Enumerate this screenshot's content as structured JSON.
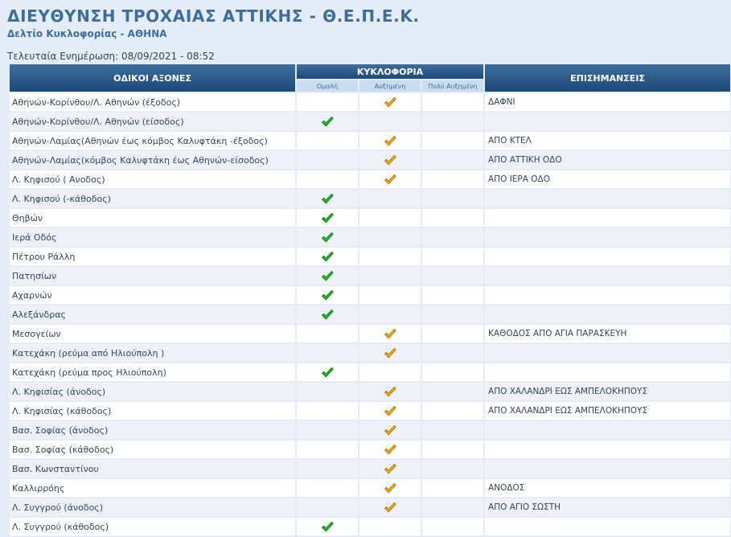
{
  "header": {
    "title": "ΔΙΕΥΘΥΝΣΗ ΤΡΟΧΑΙΑΣ ΑΤΤΙΚΗΣ - Θ.Ε.Π.Ε.Κ.",
    "subtitle": "Δελτίο Κυκλοφορίας - ΑΘΗΝΑ",
    "updated_label": "Τελευταία Ενημέρωση:",
    "updated_value": "08/09/2021 - 08:52"
  },
  "table": {
    "col_axes": "ΟΔΙΚΟΙ ΑΞΟΝΕΣ",
    "col_traffic": "ΚΥΚΛΟΦΟΡΙΑ",
    "col_notes": "ΕΠΙΣΗΜΑΝΣΕΙΣ",
    "sub_normal": "Ομαλή",
    "sub_increased": "Αυξημένη",
    "sub_very_increased": "Πολύ Αυξημένη",
    "icons": {
      "normal": "green-check-icon",
      "increased": "orange-check-icon"
    },
    "colors": {
      "normal": "#22b422",
      "increased": "#f0a818",
      "header": "#2a5a8a"
    },
    "rows": [
      {
        "axis": "Αθηνών-Κορίνθου/Λ. Αθηνών (έξοδος)",
        "status": "increased",
        "note": "ΔΑΦΝΙ"
      },
      {
        "axis": "Αθηνών-Κορίνθου/Λ. Αθηνών (είσοδος)",
        "status": "normal",
        "note": ""
      },
      {
        "axis": "Αθηνών-Λαμίας(Αθηνών έως κόμβος Καλυφτάκη -έξοδος)",
        "status": "increased",
        "note": "ΑΠΟ ΚΤΕΛ"
      },
      {
        "axis": "Αθηνών-Λαμίας(κόμβος Καλυφτάκη έως Αθηνών-είσοδος)",
        "status": "increased",
        "note": "ΑΠΟ ΑΤΤΙΚΗ ΟΔΟ"
      },
      {
        "axis": "Λ. Κηφισού ( Ανοδος)",
        "status": "increased",
        "note": "ΑΠΟ ΙΕΡΑ ΟΔΟ"
      },
      {
        "axis": "Λ. Κηφισού (-κάθοδος)",
        "status": "normal",
        "note": ""
      },
      {
        "axis": "Θηβών",
        "status": "normal",
        "note": ""
      },
      {
        "axis": "Ιερά Οδός",
        "status": "normal",
        "note": ""
      },
      {
        "axis": "Πέτρου Ράλλη",
        "status": "normal",
        "note": ""
      },
      {
        "axis": "Πατησίων",
        "status": "normal",
        "note": ""
      },
      {
        "axis": "Αχαρνών",
        "status": "normal",
        "note": ""
      },
      {
        "axis": "Αλεξάνδρας",
        "status": "normal",
        "note": ""
      },
      {
        "axis": "Μεσογείων",
        "status": "increased",
        "note": "ΚΑΘΟΔΟΣ ΑΠΟ ΑΓΙΑ ΠΑΡΑΣΚΕΥΗ"
      },
      {
        "axis": "Κατεχάκη (ρεύμα από Ηλιούπολη )",
        "status": "increased",
        "note": ""
      },
      {
        "axis": "Κατεχάκη (ρεύμα προς Ηλιούπολη)",
        "status": "normal",
        "note": ""
      },
      {
        "axis": "Λ. Κηφισίας (άνοδος)",
        "status": "increased",
        "note": "ΑΠΟ ΧΑΛΑΝΔΡΙ ΕΩΣ ΑΜΠΕΛΟΚΗΠΟΥΣ"
      },
      {
        "axis": "Λ. Κηφισίας (κάθοδος)",
        "status": "increased",
        "note": "ΑΠΟ ΧΑΛΑΝΔΡΙ ΕΩΣ ΑΜΠΕΛΟΚΗΠΟΥΣ"
      },
      {
        "axis": "Βασ. Σοφίας (άνοδος)",
        "status": "increased",
        "note": ""
      },
      {
        "axis": "Βασ. Σοφίας (κάθοδος)",
        "status": "increased",
        "note": ""
      },
      {
        "axis": "Βασ. Κωνσταντίνου",
        "status": "increased",
        "note": ""
      },
      {
        "axis": "Καλλιρρόης",
        "status": "increased",
        "note": "ΑΝΟΔΟΣ"
      },
      {
        "axis": "Λ. Συγγρού (άνοδος)",
        "status": "increased",
        "note": "ΑΠΟ ΑΓΙΟ ΣΩΣΤΗ"
      },
      {
        "axis": "Λ. Συγγρού (κάθοδος)",
        "status": "normal",
        "note": ""
      }
    ]
  }
}
